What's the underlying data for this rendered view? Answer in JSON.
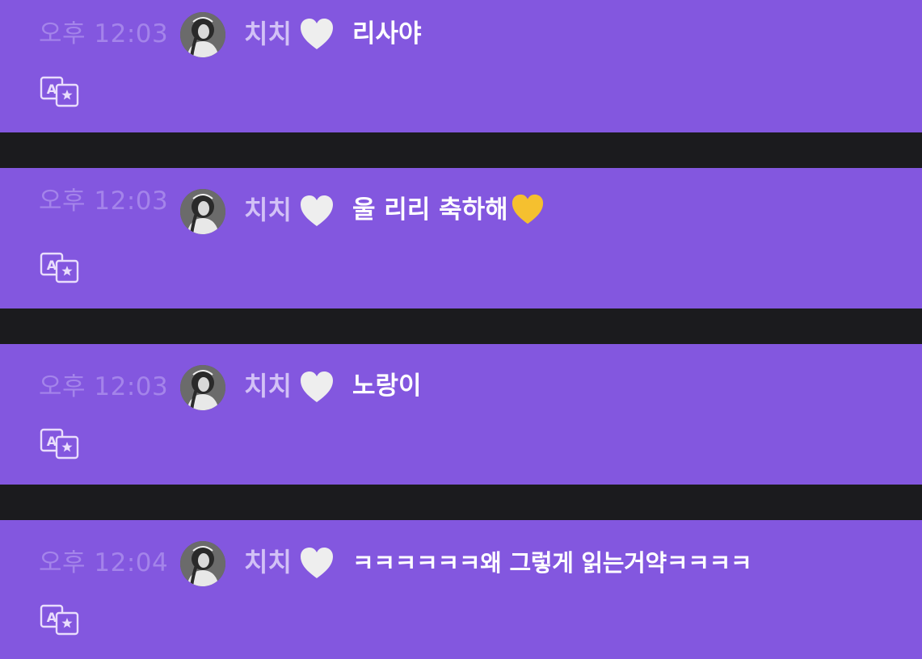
{
  "colors": {
    "message_bg": "#8357df",
    "divider": "#1b1b1e",
    "timestamp": "#a484ea",
    "sender_name": "#d2c1f6",
    "message_text": "#ffffff",
    "white_heart": "#eeeeee",
    "yellow_heart": "#f5c02f"
  },
  "messages": [
    {
      "time": "오후 12:03",
      "sender": "치치",
      "sender_emoji": "white-heart-icon",
      "text": "리사야"
    },
    {
      "time": "오후 12:03",
      "sender": "치치",
      "sender_emoji": "white-heart-icon",
      "text": "울 리리 축하해",
      "trailing_emoji": "yellow-heart-icon"
    },
    {
      "time": "오후 12:03",
      "sender": "치치",
      "sender_emoji": "white-heart-icon",
      "text": "노랑이"
    },
    {
      "time": "오후 12:04",
      "sender": "치치",
      "sender_emoji": "white-heart-icon",
      "text": "ㅋㅋㅋㅋㅋㅋ왜 그렇게 읽는거약ㅋㅋㅋㅋ"
    }
  ]
}
